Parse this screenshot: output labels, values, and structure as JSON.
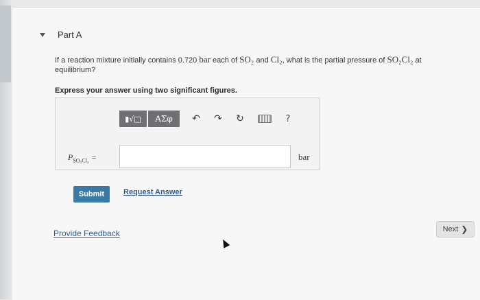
{
  "part": {
    "title": "Part A"
  },
  "question": {
    "text_before": "If a reaction mixture initially contains 0.720",
    "unit_bar": "bar",
    "text_each": "each of",
    "species1": "SO₂",
    "text_and": "and",
    "species2": "Cl₂",
    "text_ask": ", what is the partial pressure of",
    "species3": "SO₂Cl₂",
    "text_after": "at equilibrium?"
  },
  "instruction": "Express your answer using two significant figures.",
  "toolbar": {
    "templates_label": "▮√□",
    "symbols_label": "ΑΣφ",
    "undo_icon": "↶",
    "redo_icon": "↷",
    "reset_icon": "↻",
    "help_label": "?"
  },
  "answer": {
    "variable_main": "P",
    "variable_sub": "SO₂Cl₂",
    "equals": "=",
    "value": "",
    "unit": "bar"
  },
  "actions": {
    "submit_label": "Submit",
    "request_label": "Request Answer"
  },
  "footer": {
    "feedback_label": "Provide Feedback",
    "next_label": "Next",
    "next_icon": "❯"
  },
  "colors": {
    "submit": "#3a7aa7",
    "link": "#315d8c",
    "toolbar_button": "#6e7073"
  }
}
